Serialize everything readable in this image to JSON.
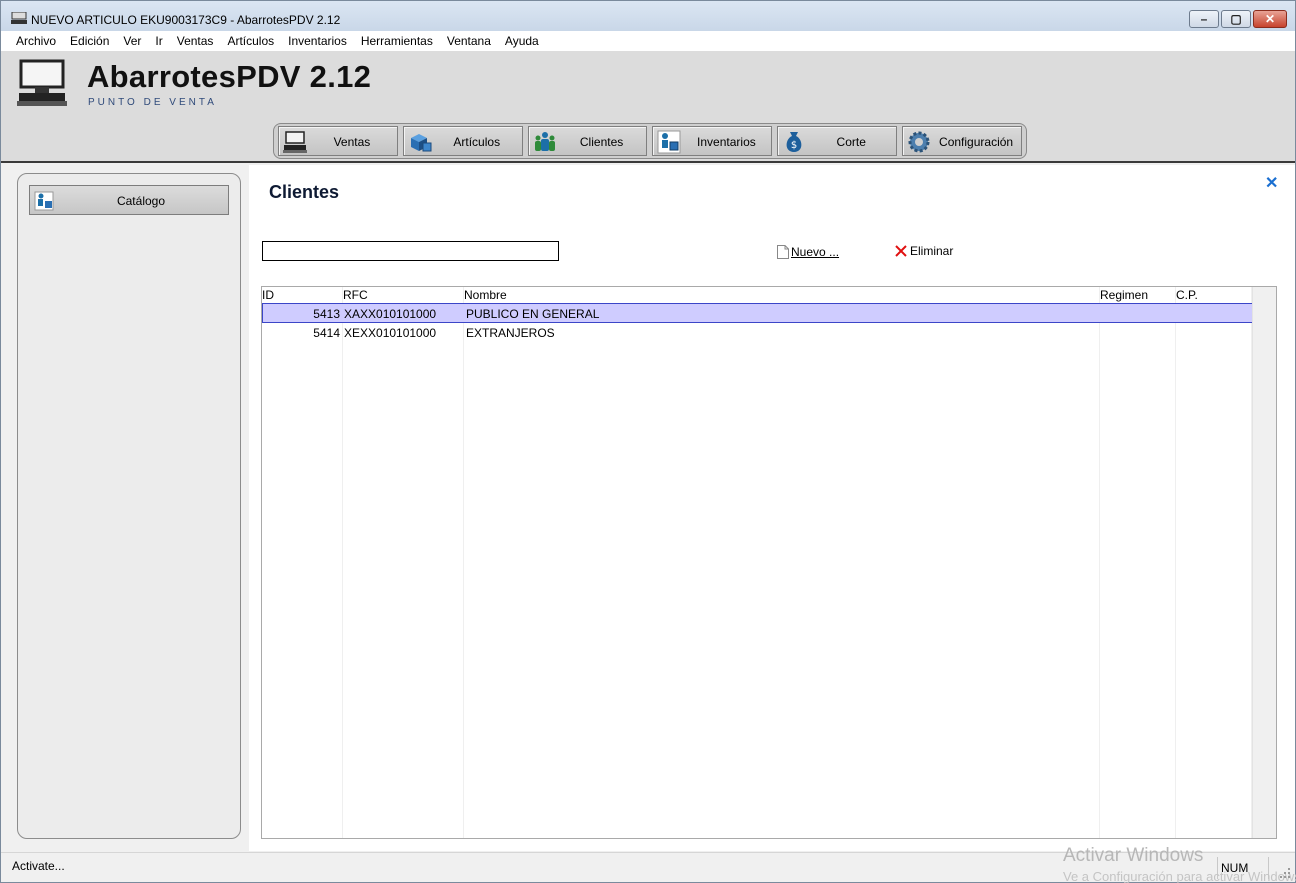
{
  "window": {
    "title": "NUEVO ARTICULO EKU9003173C9 - AbarrotesPDV 2.12",
    "controls": {
      "minimize": "–",
      "maximize": "▢",
      "close": "✕"
    }
  },
  "menu": [
    "Archivo",
    "Edición",
    "Ver",
    "Ir",
    "Ventas",
    "Artículos",
    "Inventarios",
    "Herramientas",
    "Ventana",
    "Ayuda"
  ],
  "header": {
    "brand": "AbarrotesPDV 2.12",
    "subtitle": "PUNTO DE VENTA"
  },
  "toolbar": [
    {
      "label": "Ventas",
      "icon": "register-icon"
    },
    {
      "label": "Artículos",
      "icon": "boxes-icon"
    },
    {
      "label": "Clientes",
      "icon": "clients-icon"
    },
    {
      "label": "Inventarios",
      "icon": "inventory-icon"
    },
    {
      "label": "Corte",
      "icon": "money-bag-icon"
    },
    {
      "label": "Configuración",
      "icon": "gear-icon"
    }
  ],
  "sidebar": {
    "catalog_label": "Catálogo"
  },
  "main": {
    "title": "Clientes",
    "close": "✕",
    "search_value": "",
    "new_label": "Nuevo ...",
    "delete_label": "Eliminar"
  },
  "table": {
    "columns": [
      "ID",
      "RFC",
      "Nombre",
      "Regimen",
      "C.P."
    ],
    "rows": [
      {
        "id": "5413",
        "rfc": "XAXX010101000",
        "nombre": "PUBLICO EN GENERAL",
        "regimen": "",
        "cp": "",
        "selected": true
      },
      {
        "id": "5414",
        "rfc": "XEXX010101000",
        "nombre": "EXTRANJEROS",
        "regimen": "",
        "cp": "",
        "selected": false
      }
    ]
  },
  "status": {
    "text": "Activate...",
    "num": "NUM",
    "watermark_title": "Activar Windows",
    "watermark_sub": "Ve a Configuración para activar Windows."
  },
  "colors": {
    "selection": "#cfccff",
    "selection_border": "#3b46c8",
    "close_accent": "#1a6fd1",
    "delete_accent": "#e01010"
  }
}
